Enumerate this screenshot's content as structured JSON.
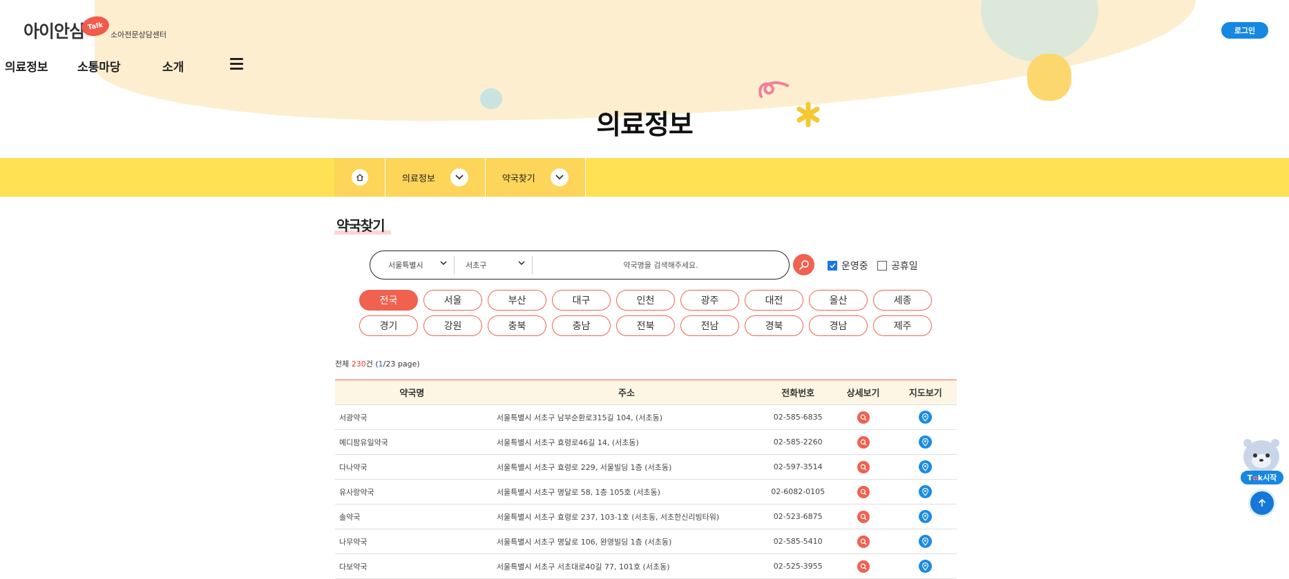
{
  "header": {
    "logo_main": "아이안심",
    "logo_talk": "Talk",
    "logo_sub": "소아전문상담센터",
    "nav": [
      "의료정보",
      "소통마당",
      "소개"
    ],
    "login_label": "로그인"
  },
  "page_title": "의료정보",
  "breadcrumb": {
    "home_icon": "home-icon",
    "items": [
      "의료정보",
      "약국찾기"
    ]
  },
  "section_title": "약국찾기",
  "search": {
    "city_value": "서울특별시",
    "district_value": "서초구",
    "placeholder": "약국명을 검색해주세요.",
    "filters": [
      {
        "label": "운영중",
        "checked": true
      },
      {
        "label": "공휴일",
        "checked": false
      }
    ]
  },
  "regions": {
    "active": "전국",
    "items": [
      "전국",
      "서울",
      "부산",
      "대구",
      "인천",
      "광주",
      "대전",
      "울산",
      "세종",
      "경기",
      "강원",
      "충북",
      "충남",
      "전북",
      "전남",
      "경북",
      "경남",
      "제주"
    ]
  },
  "summary": {
    "prefix": "전체",
    "count": "230",
    "unit": "건 (",
    "page": "1",
    "pages_suffix": "/23 page)"
  },
  "table": {
    "headers": [
      "약국명",
      "주소",
      "전화번호",
      "상세보기",
      "지도보기"
    ],
    "rows": [
      {
        "name": "서광약국",
        "address": "서울특별시 서초구 남부순환로315길 104, (서초동)",
        "phone": "02-585-6835"
      },
      {
        "name": "메디팜유일약국",
        "address": "서울특별시 서초구 효령로46길 14, (서초동)",
        "phone": "02-585-2260"
      },
      {
        "name": "다나약국",
        "address": "서울특별시 서초구 효령로 229, 서울빌딩 1층 (서초동)",
        "phone": "02-597-3514"
      },
      {
        "name": "유사랑약국",
        "address": "서울특별시 서초구 명달로 58, 1층 105호 (서초동)",
        "phone": "02-6082-0105"
      },
      {
        "name": "솔약국",
        "address": "서울특별시 서초구 효령로 237, 103-1호 (서초동, 서초한신리빙타워)",
        "phone": "02-523-6875"
      },
      {
        "name": "나무약국",
        "address": "서울특별시 서초구 명달로 106, 완영빌딩 1층 (서초동)",
        "phone": "02-585-5410"
      },
      {
        "name": "다보약국",
        "address": "서울특별시 서초구 서초대로40길 77, 101호 (서초동)",
        "phone": "02-525-3955"
      }
    ]
  },
  "floating": {
    "talk_start_prefix": "T",
    "talk_start_o": "o",
    "talk_start_suffix": "k시작",
    "top_icon": "arrow-up-icon"
  },
  "colors": {
    "accent_red": "#f0614f",
    "yellow_bar": "#ffe153",
    "blue": "#1687e2"
  }
}
